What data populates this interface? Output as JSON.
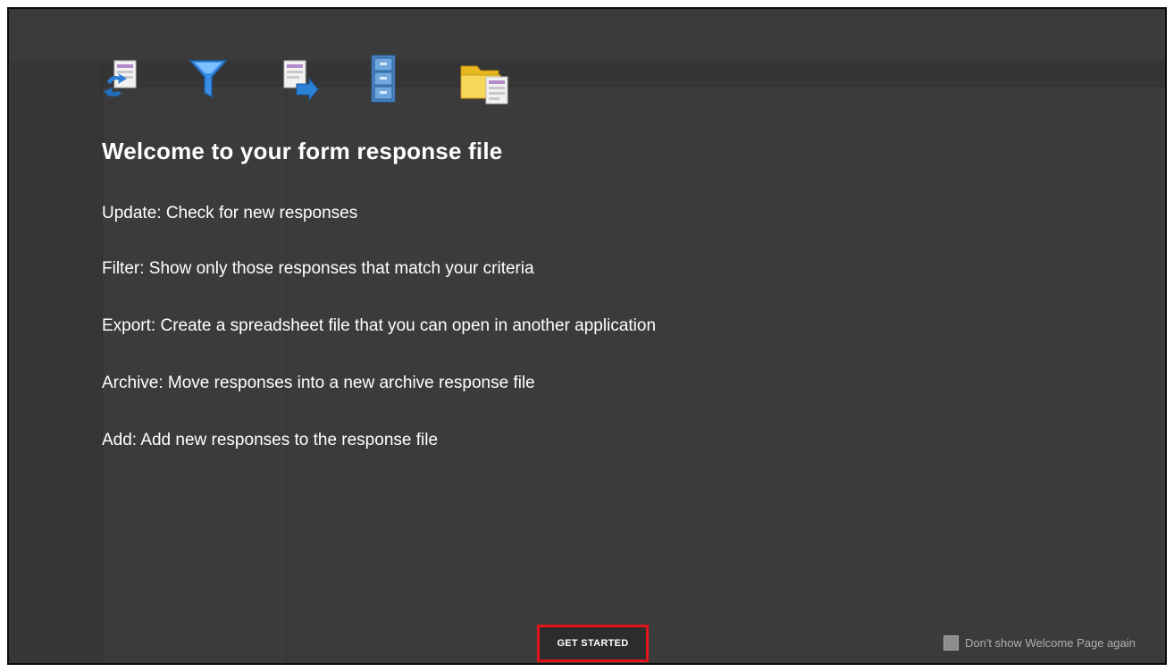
{
  "welcome": {
    "title": "Welcome to your form response file",
    "features": [
      {
        "icon": "update-icon",
        "text": "Update: Check for new responses"
      },
      {
        "icon": "filter-icon",
        "text": "Filter: Show only those responses that match your criteria"
      },
      {
        "icon": "export-icon",
        "text": "Export: Create a spreadsheet file that you can open in another application"
      },
      {
        "icon": "archive-icon",
        "text": "Archive: Move responses into a new archive response file"
      },
      {
        "icon": "add-icon",
        "text": "Add: Add new responses to the response file"
      }
    ],
    "get_started_label": "GET STARTED",
    "dont_show_label": "Don't show Welcome Page again",
    "dont_show_checked": false
  },
  "colors": {
    "background": "#3b3b3b",
    "text": "#ffffff",
    "highlight": "#e0141b"
  }
}
